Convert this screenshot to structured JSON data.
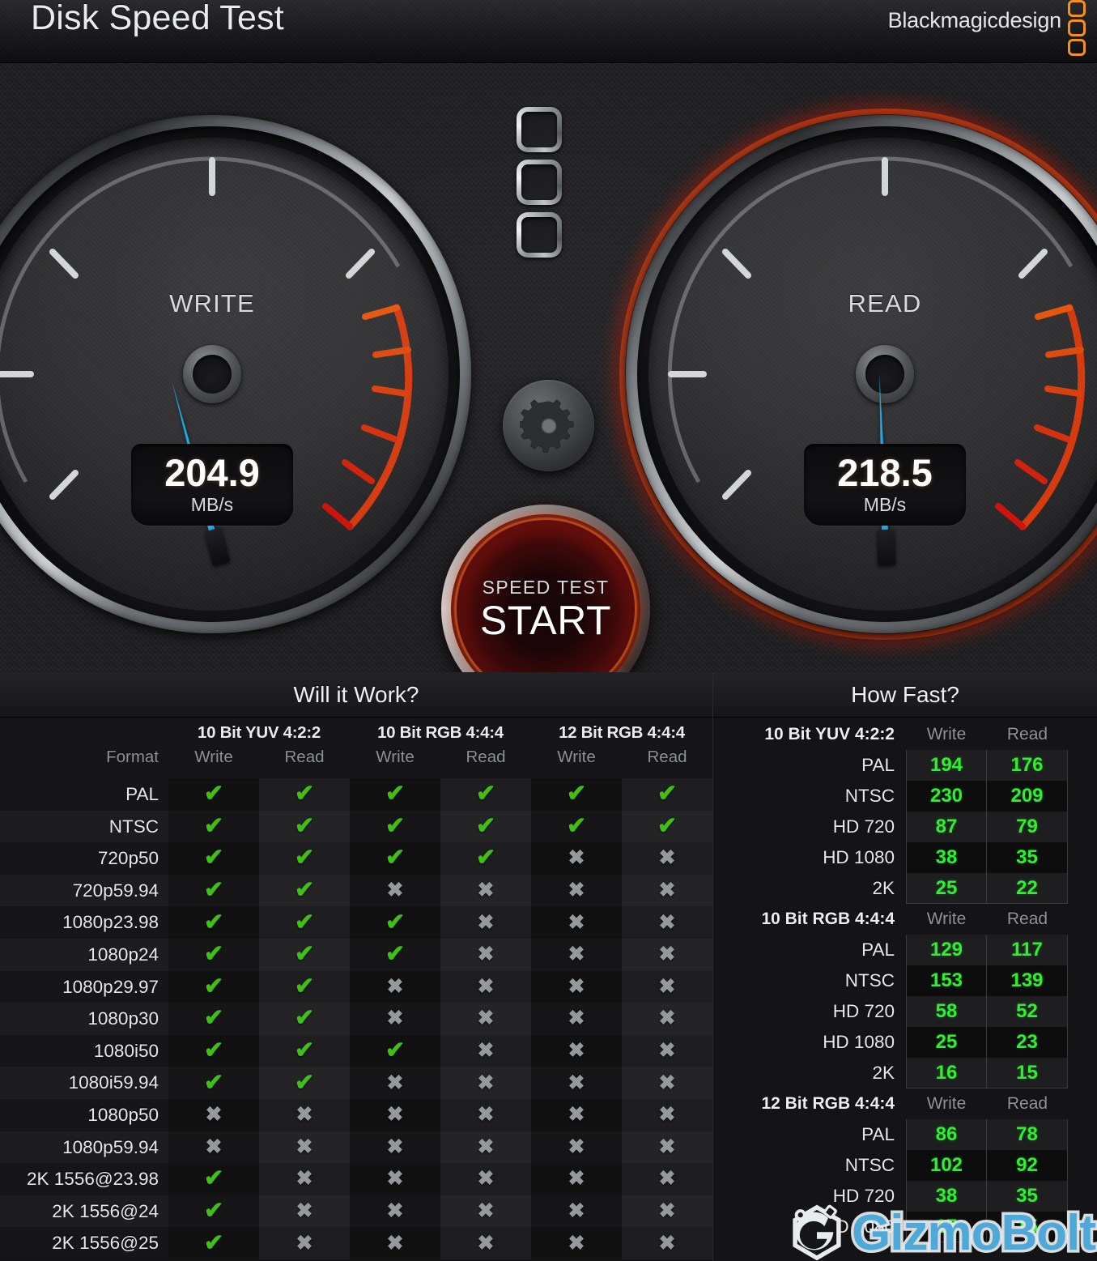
{
  "header": {
    "title": "Disk Speed Test",
    "brand": "Blackmagicdesign"
  },
  "gauges": {
    "write": {
      "label": "WRITE",
      "value": "204.9",
      "unit": "MB/s",
      "needle_deg": -15,
      "active": false
    },
    "read": {
      "label": "READ",
      "value": "218.5",
      "unit": "MB/s",
      "needle_deg": -2,
      "active": true
    }
  },
  "controls": {
    "start_button": {
      "sub_label": "SPEED TEST",
      "main_label": "START"
    },
    "settings_icon": "gear-icon",
    "stress_leds": 3
  },
  "will_it_work": {
    "title": "Will it Work?",
    "format_header": "Format",
    "groups": [
      "10 Bit YUV 4:2:2",
      "10 Bit RGB 4:4:4",
      "12 Bit RGB 4:4:4"
    ],
    "sub_headers": [
      "Write",
      "Read",
      "Write",
      "Read",
      "Write",
      "Read"
    ],
    "rows": [
      {
        "format": "PAL",
        "cells": [
          1,
          1,
          1,
          1,
          1,
          1
        ]
      },
      {
        "format": "NTSC",
        "cells": [
          1,
          1,
          1,
          1,
          1,
          1
        ]
      },
      {
        "format": "720p50",
        "cells": [
          1,
          1,
          1,
          1,
          0,
          0
        ]
      },
      {
        "format": "720p59.94",
        "cells": [
          1,
          1,
          0,
          0,
          0,
          0
        ]
      },
      {
        "format": "1080p23.98",
        "cells": [
          1,
          1,
          1,
          0,
          0,
          0
        ]
      },
      {
        "format": "1080p24",
        "cells": [
          1,
          1,
          1,
          0,
          0,
          0
        ]
      },
      {
        "format": "1080p29.97",
        "cells": [
          1,
          1,
          0,
          0,
          0,
          0
        ]
      },
      {
        "format": "1080p30",
        "cells": [
          1,
          1,
          0,
          0,
          0,
          0
        ]
      },
      {
        "format": "1080i50",
        "cells": [
          1,
          1,
          1,
          0,
          0,
          0
        ]
      },
      {
        "format": "1080i59.94",
        "cells": [
          1,
          1,
          0,
          0,
          0,
          0
        ]
      },
      {
        "format": "1080p50",
        "cells": [
          0,
          0,
          0,
          0,
          0,
          0
        ]
      },
      {
        "format": "1080p59.94",
        "cells": [
          0,
          0,
          0,
          0,
          0,
          0
        ]
      },
      {
        "format": "2K 1556@23.98",
        "cells": [
          1,
          0,
          0,
          0,
          0,
          0
        ]
      },
      {
        "format": "2K 1556@24",
        "cells": [
          1,
          0,
          0,
          0,
          0,
          0
        ]
      },
      {
        "format": "2K 1556@25",
        "cells": [
          1,
          0,
          0,
          0,
          0,
          0
        ]
      }
    ],
    "mark_yes": "✔",
    "mark_no": "✖"
  },
  "how_fast": {
    "title": "How Fast?",
    "col_write": "Write",
    "col_read": "Read",
    "groups": [
      {
        "name": "10 Bit YUV 4:2:2",
        "rows": [
          {
            "label": "PAL",
            "write": "194",
            "read": "176"
          },
          {
            "label": "NTSC",
            "write": "230",
            "read": "209"
          },
          {
            "label": "HD 720",
            "write": "87",
            "read": "79"
          },
          {
            "label": "HD 1080",
            "write": "38",
            "read": "35"
          },
          {
            "label": "2K",
            "write": "25",
            "read": "22"
          }
        ]
      },
      {
        "name": "10 Bit RGB 4:4:4",
        "rows": [
          {
            "label": "PAL",
            "write": "129",
            "read": "117"
          },
          {
            "label": "NTSC",
            "write": "153",
            "read": "139"
          },
          {
            "label": "HD 720",
            "write": "58",
            "read": "52"
          },
          {
            "label": "HD 1080",
            "write": "25",
            "read": "23"
          },
          {
            "label": "2K",
            "write": "16",
            "read": "15"
          }
        ]
      },
      {
        "name": "12 Bit RGB 4:4:4",
        "rows": [
          {
            "label": "PAL",
            "write": "86",
            "read": "78"
          },
          {
            "label": "NTSC",
            "write": "102",
            "read": "92"
          },
          {
            "label": "HD 720",
            "write": "38",
            "read": "35"
          },
          {
            "label": "HD 1080",
            "write": "17",
            "read": "15"
          }
        ]
      }
    ]
  },
  "watermark": {
    "text_a": "Gizmo",
    "text_b": "Bolt"
  },
  "colors": {
    "accent_orange": "#f5941e",
    "needle_blue": "#1da9e8",
    "value_green": "#2ef02e",
    "check_green": "#3fc017",
    "cross_grey": "#96999c",
    "red_glow": "#c93016"
  }
}
